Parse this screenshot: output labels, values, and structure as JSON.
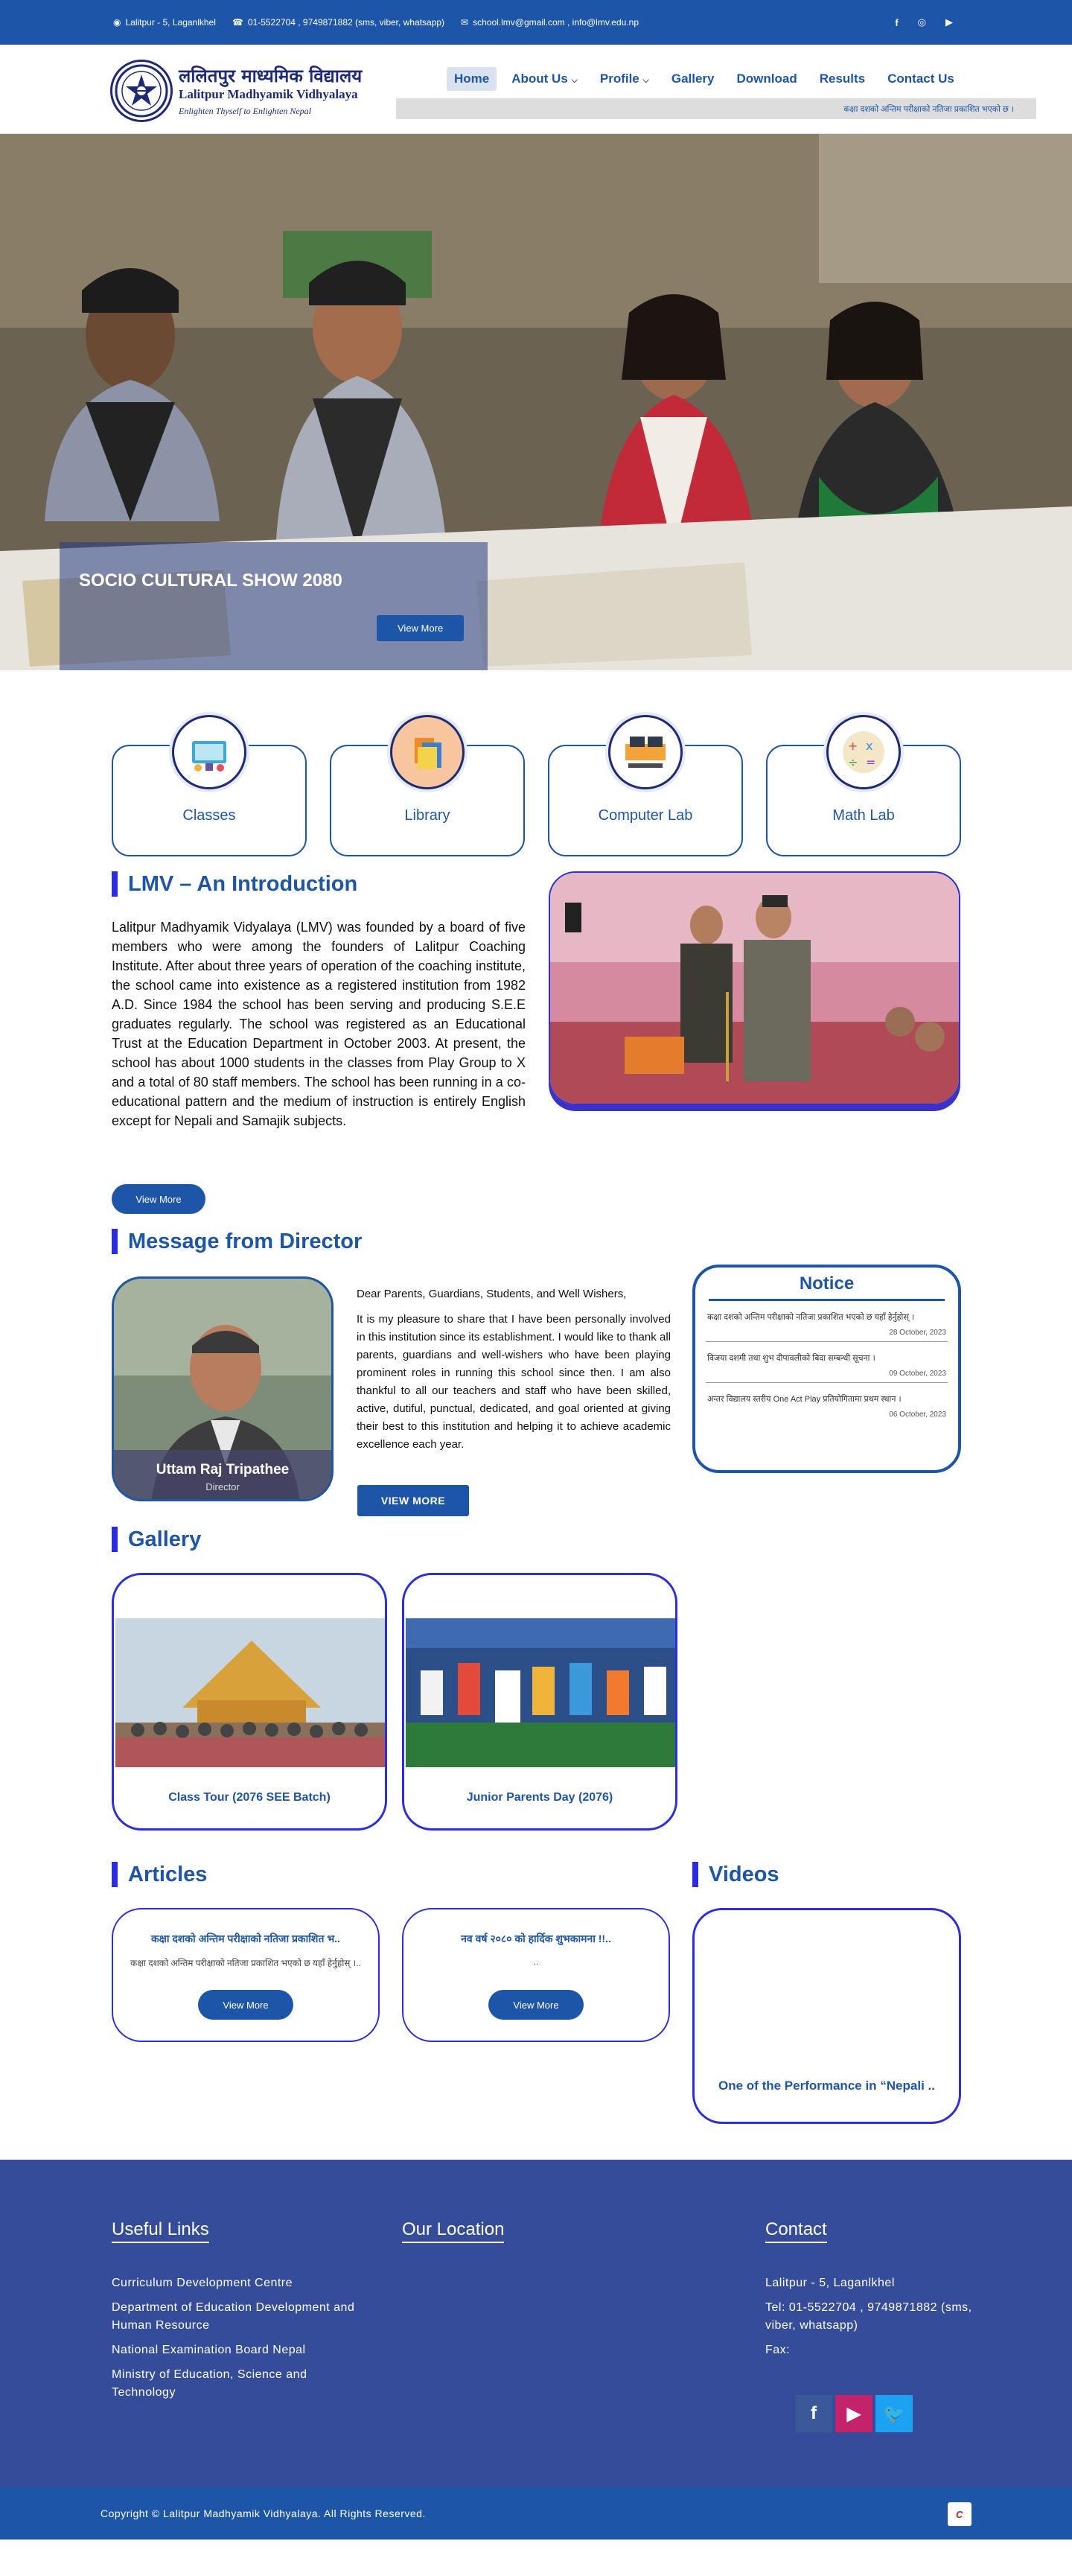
{
  "topbar": {
    "address": "Lalitpur - 5, Laganlkhel",
    "phone": "01-5522704 , 9749871882 (sms, viber, whatsapp)",
    "email": "school.lmv@gmail.com , info@lmv.edu.np",
    "socials": [
      "facebook-icon",
      "instagram-icon",
      "youtube-icon"
    ]
  },
  "header": {
    "logo_np": "ललितपुर माध्यमिक विद्यालय",
    "logo_en": "Lalitpur Madhyamik Vidhyalaya",
    "logo_tag": "Enlighten Thyself to Enlighten Nepal",
    "nav": [
      {
        "label": "Home",
        "active": true
      },
      {
        "label": "About Us",
        "dropdown": true
      },
      {
        "label": "Profile",
        "dropdown": true
      },
      {
        "label": "Gallery"
      },
      {
        "label": "Download"
      },
      {
        "label": "Results"
      },
      {
        "label": "Contact Us"
      }
    ],
    "ticker": "कक्षा दशको अन्तिम परीक्षाको नतिजा प्रकाशित भएको छ ।"
  },
  "hero": {
    "caption": "SOCIO CULTURAL SHOW 2080",
    "button": "View More"
  },
  "facilities": [
    {
      "label": "Classes",
      "icon": "classes-icon"
    },
    {
      "label": "Library",
      "icon": "library-icon"
    },
    {
      "label": "Computer Lab",
      "icon": "computer-lab-icon"
    },
    {
      "label": "Math Lab",
      "icon": "math-lab-icon"
    }
  ],
  "intro": {
    "title": "LMV – An Introduction",
    "text": "Lalitpur Madhyamik Vidyalaya (LMV) was founded by a board of five members who were among the founders of Lalitpur Coaching Institute. After about three years of operation of the coaching institute, the school came into existence as a registered institution from 1982 A.D. Since 1984 the school has been serving and producing S.E.E graduates regularly. The school was registered as an Educational Trust at the Education Department in October 2003. At present, the school has about 1000 students in the classes from Play Group to X and a total of 80 staff members. The school has been running in a co-educational pattern and the medium of instruction is entirely English except for Nepali and Samajik subjects.",
    "button": "View More"
  },
  "director": {
    "title": "Message from Director",
    "name": "Uttam Raj Tripathee",
    "role": "Director",
    "greeting": "Dear Parents, Guardians, Students, and Well Wishers,",
    "message": "It is my pleasure to share that I have been personally involved in this institution since its establishment. I would like to thank all parents, guardians and well-wishers who have been playing prominent roles in running this school since then. I am also thankful to all our teachers and staff who have been skilled, active, dutiful, punctual, dedicated, and goal oriented at giving their best to this institution and helping it to achieve academic excellence each year.",
    "button": "VIEW MORE"
  },
  "notice": {
    "title": "Notice",
    "items": [
      {
        "text": "कक्षा दशको अन्तिम परीक्षाको नतिजा प्रकाशित भएको छ यहाँ हेर्नुहोस् ।",
        "date": "28 October, 2023"
      },
      {
        "text": "विजया दशमी तथा शुभ दीपावलीको बिदा सम्बन्धी सूचना ।",
        "date": "09 October, 2023"
      },
      {
        "text": "अन्तर विद्यालय स्तरीय One Act Play प्रतियोगितामा प्रथम स्थान ।",
        "date": "06 October, 2023"
      }
    ]
  },
  "gallery": {
    "title": "Gallery",
    "items": [
      {
        "caption": "Class Tour (2076 SEE Batch)"
      },
      {
        "caption": "Junior Parents Day (2076)"
      }
    ]
  },
  "articles": {
    "title": "Articles",
    "items": [
      {
        "title": "कक्षा दशको अन्तिम परीक्षाको नतिजा प्रकाशित भ..",
        "desc": "कक्षा दशको अन्तिम परीक्षाको नतिजा प्रकाशित भएको छ यहाँ हेर्नुहोस् ।..",
        "button": "View More"
      },
      {
        "title": "नव वर्ष २०८० को हार्दिक शुभकामना !!..",
        "desc": "..",
        "button": "View More"
      }
    ]
  },
  "videos": {
    "title": "Videos",
    "caption": "One of the Performance in “Nepali .."
  },
  "footer": {
    "useful_title": "Useful Links",
    "location_title": "Our Location",
    "contact_title": "Contact",
    "links": [
      "Curriculum Development Centre",
      "Department of Education Development and Human Resource",
      "National Examination Board Nepal",
      "Ministry of Education, Science and Technology"
    ],
    "address": "Lalitpur - 5, Laganlkhel",
    "tel": "Tel: 01-5522704 , 9749871882 (sms, viber, whatsapp)",
    "fax": "Fax:",
    "social_colors": {
      "facebook": "#3b5998",
      "youtube": "#c4236b",
      "twitter": "#1da1f2"
    },
    "copyright": "Copyright © Lalitpur Madhyamik Vidhyalaya. All Rights Reserved."
  },
  "colors": {
    "primary": "#1d56a8",
    "accent": "#2a2ee0",
    "footer": "#344c9a"
  }
}
